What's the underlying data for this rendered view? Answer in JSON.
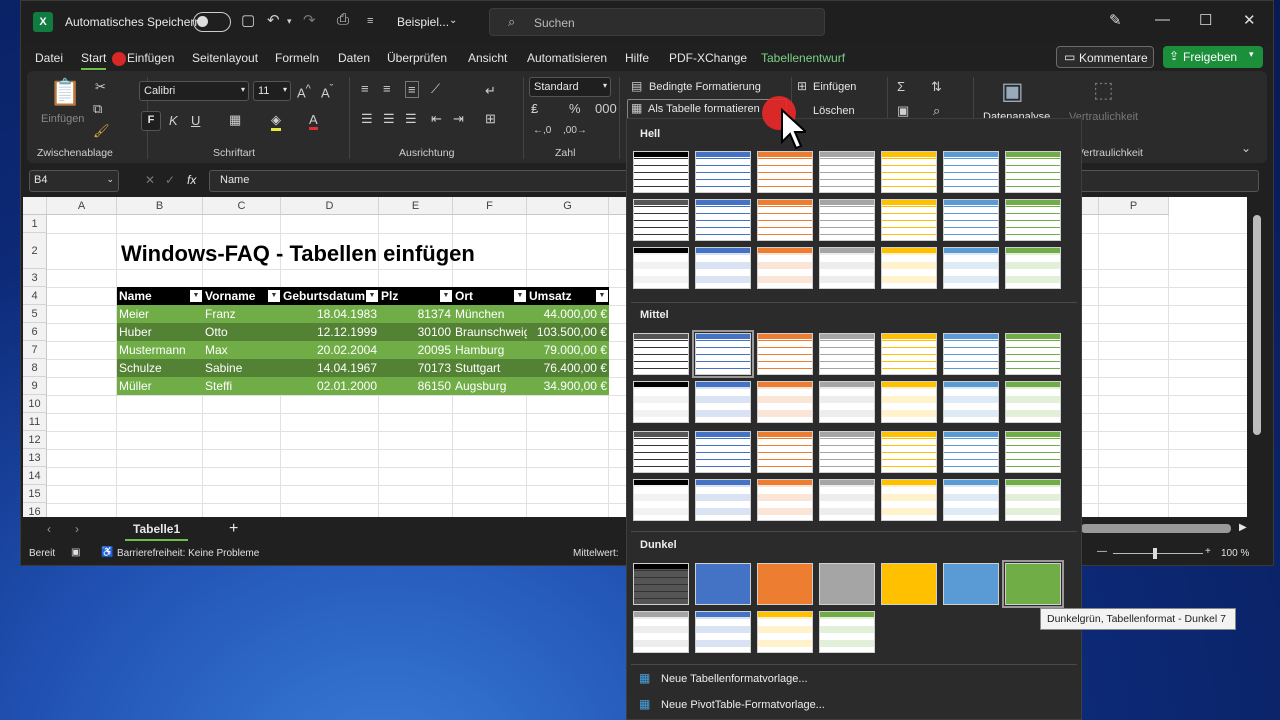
{
  "window": {
    "autosave_label": "Automatisches Speichern",
    "file_name": "Beispiel...",
    "search_placeholder": "Suchen"
  },
  "tabs": [
    "Datei",
    "Start",
    "Einfügen",
    "Seitenlayout",
    "Formeln",
    "Daten",
    "Überprüfen",
    "Ansicht",
    "Automatisieren",
    "Hilfe",
    "PDF-XChange",
    "Tabellenentwurf"
  ],
  "buttons": {
    "kommentare": "Kommentare",
    "freigeben": "Freigeben"
  },
  "ribbon": {
    "paste": "Einfügen",
    "clipboard": "Zwischenablage",
    "font_name": "Calibri",
    "font_size": "11",
    "font_group": "Schriftart",
    "align_group": "Ausrichtung",
    "number_format": "Standard",
    "number_group": "Zahl",
    "cond_format": "Bedingte Formatierung",
    "as_table": "Als Tabelle formatieren",
    "insert": "Einfügen",
    "delete": "Löschen",
    "analyze": "Datenanalyse",
    "sensitivity": "Vertraulichkeit",
    "sensitivity_group": "Vertraulichkeit",
    "bold": "F",
    "italic": "K",
    "underline": "U"
  },
  "formula": {
    "cell_ref": "B4",
    "fx": "fx",
    "content": "Name"
  },
  "grid": {
    "columns": [
      "A",
      "B",
      "C",
      "D",
      "E",
      "F",
      "G",
      "",
      "",
      "",
      "",
      "",
      "",
      "O",
      "P"
    ],
    "rows": [
      "1",
      "2",
      "3",
      "4",
      "5",
      "6",
      "7",
      "8",
      "9",
      "10",
      "11",
      "12",
      "13",
      "14",
      "15",
      "16"
    ],
    "title": "Windows-FAQ - Tabellen einfügen",
    "headers": [
      "Name",
      "Vorname",
      "Geburtsdatum",
      "Plz",
      "Ort",
      "Umsatz"
    ],
    "data": [
      [
        "Meier",
        "Franz",
        "18.04.1983",
        "81374",
        "München",
        "44.000,00 €"
      ],
      [
        "Huber",
        "Otto",
        "12.12.1999",
        "30100",
        "Braunschweig",
        "103.500,00 €"
      ],
      [
        "Mustermann",
        "Max",
        "20.02.2004",
        "20095",
        "Hamburg",
        "79.000,00 €"
      ],
      [
        "Schulze",
        "Sabine",
        "14.04.1967",
        "70173",
        "Stuttgart",
        "76.400,00 €"
      ],
      [
        "Müller",
        "Steffi",
        "02.01.2000",
        "86150",
        "Augsburg",
        "34.900,00 €"
      ]
    ]
  },
  "sheet": {
    "tab": "Tabelle1",
    "add": "+"
  },
  "status": {
    "ready": "Bereit",
    "accessibility": "Barrierefreiheit: Keine Probleme",
    "mittelwert": "Mittelwert:",
    "zoom": "100 %"
  },
  "gallery": {
    "hell": "Hell",
    "mittel": "Mittel",
    "dunkel": "Dunkel",
    "new_table_style": "Neue Tabellenformatvorlage...",
    "new_pivot_style": "Neue PivotTable-Formatvorlage..."
  },
  "tooltip": "Dunkelgrün, Tabellenformat - Dunkel 7",
  "colors": {
    "accent_green": "#107c41",
    "table_header": "#000000",
    "band_light": "#70ad47",
    "band_dark": "#548235",
    "tab_context": "#7bd088"
  }
}
